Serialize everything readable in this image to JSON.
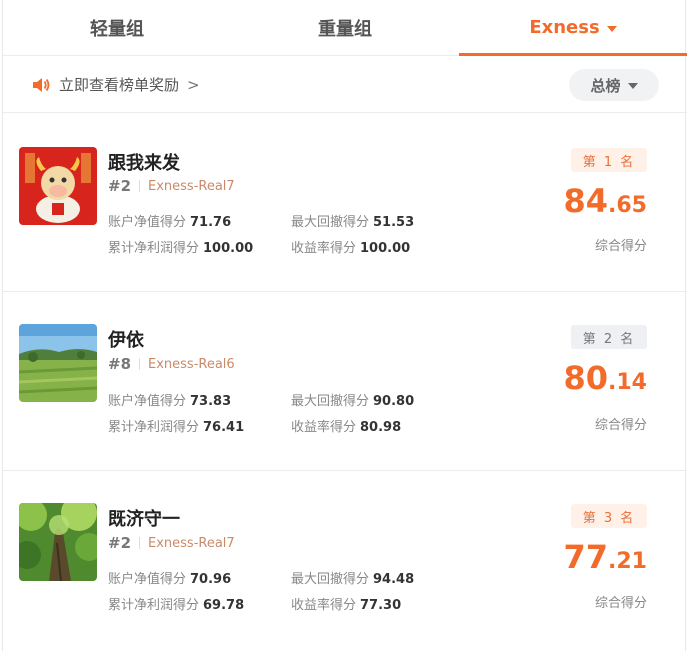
{
  "tabs": [
    {
      "label": "轻量组",
      "active": false
    },
    {
      "label": "重量组",
      "active": false
    },
    {
      "label": "Exness",
      "active": true
    }
  ],
  "notice": {
    "text": "立即查看榜单奖励",
    "arrow": ">",
    "icon": "speaker-icon"
  },
  "filter": {
    "label": "总榜"
  },
  "colors": {
    "accent": "#f26b2a"
  },
  "score_label": "综合得分",
  "traders": [
    {
      "name": "跟我来发",
      "rank": "#2",
      "account": "Exness-Real7",
      "badge": "第 1 名",
      "badge_style": "orange",
      "score_int": "84",
      "score_dec": ".65",
      "stats": {
        "net_value_label": "账户净值得分",
        "net_value": "71.76",
        "drawdown_label": "最大回撤得分",
        "drawdown": "51.53",
        "profit_label": "累计净利润得分",
        "profit": "100.00",
        "return_label": "收益率得分",
        "return": "100.00"
      },
      "avatar": "ox-avatar"
    },
    {
      "name": "伊依",
      "rank": "#8",
      "account": "Exness-Real6",
      "badge": "第 2 名",
      "badge_style": "grey",
      "score_int": "80",
      "score_dec": ".14",
      "stats": {
        "net_value_label": "账户净值得分",
        "net_value": "73.83",
        "drawdown_label": "最大回撤得分",
        "drawdown": "90.80",
        "profit_label": "累计净利润得分",
        "profit": "76.41",
        "return_label": "收益率得分",
        "return": "80.98"
      },
      "avatar": "field-avatar"
    },
    {
      "name": "既济守一",
      "rank": "#2",
      "account": "Exness-Real7",
      "badge": "第 3 名",
      "badge_style": "orange",
      "score_int": "77",
      "score_dec": ".21",
      "stats": {
        "net_value_label": "账户净值得分",
        "net_value": "70.96",
        "drawdown_label": "最大回撤得分",
        "drawdown": "94.48",
        "profit_label": "累计净利润得分",
        "profit": "69.78",
        "return_label": "收益率得分",
        "return": "77.30"
      },
      "avatar": "tree-avatar"
    }
  ]
}
